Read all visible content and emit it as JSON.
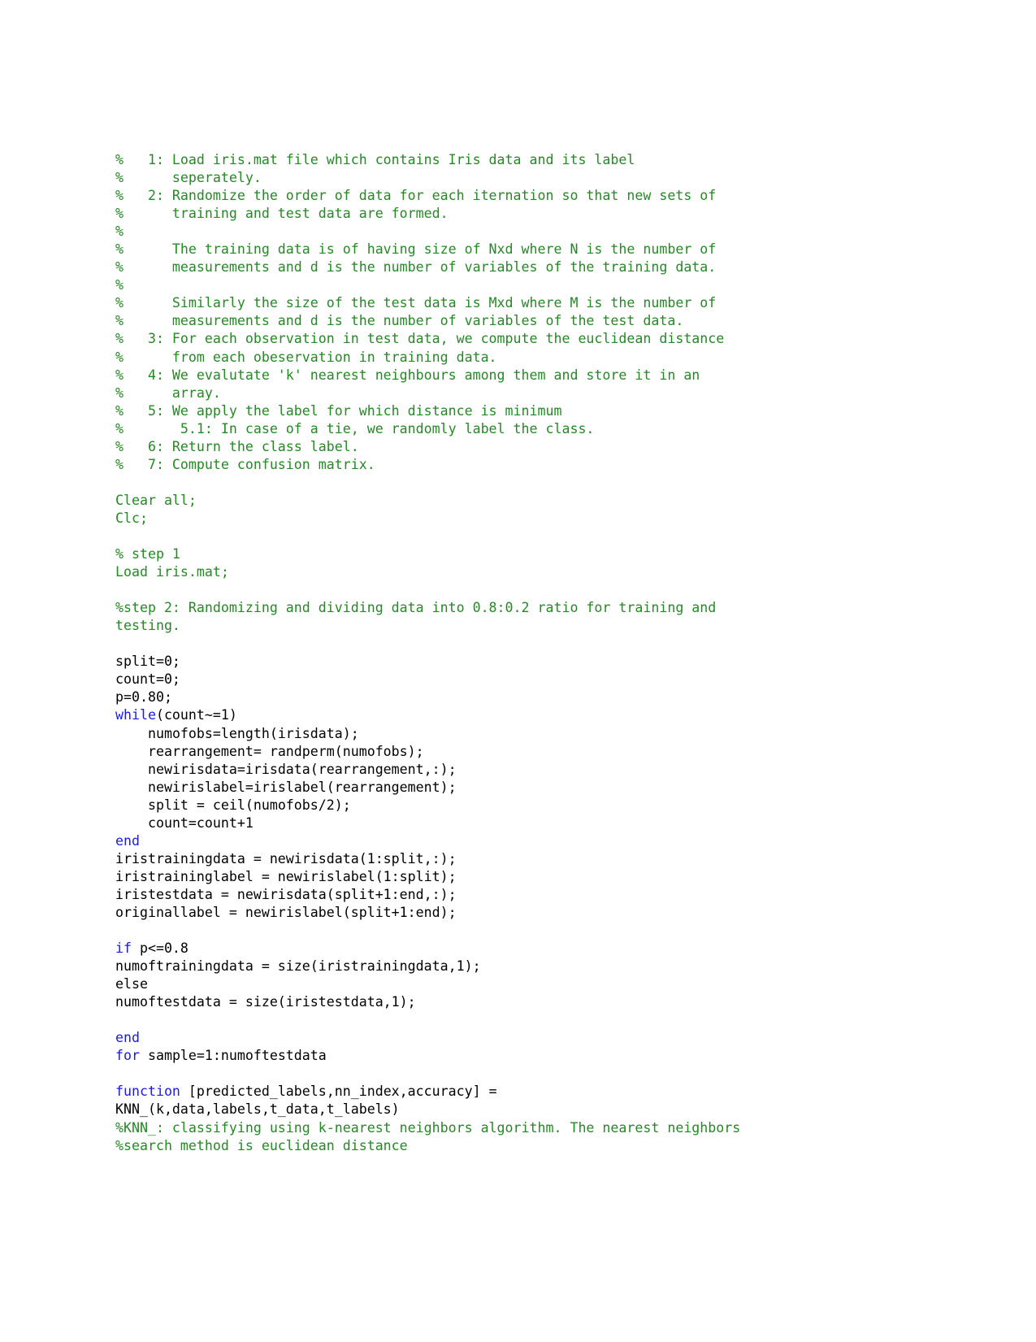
{
  "document": {
    "type": "matlab-source-listing",
    "page_background": "#ffffff",
    "colors": {
      "comment": "#228b22",
      "keyword": "#1a1aee",
      "code": "#000000"
    },
    "lines": [
      {
        "id": "l1",
        "kind": "comment",
        "text": "%   1: Load iris.mat file which contains Iris data and its label"
      },
      {
        "id": "l2",
        "kind": "comment",
        "text": "%      seperately."
      },
      {
        "id": "l3",
        "kind": "comment",
        "text": "%   2: Randomize the order of data for each iternation so that new sets of"
      },
      {
        "id": "l4",
        "kind": "comment",
        "text": "%      training and test data are formed."
      },
      {
        "id": "l5",
        "kind": "comment",
        "text": "%"
      },
      {
        "id": "l6",
        "kind": "comment",
        "text": "%      The training data is of having size of Nxd where N is the number of"
      },
      {
        "id": "l7",
        "kind": "comment",
        "text": "%      measurements and d is the number of variables of the training data."
      },
      {
        "id": "l8",
        "kind": "comment",
        "text": "%"
      },
      {
        "id": "l9",
        "kind": "comment",
        "text": "%      Similarly the size of the test data is Mxd where M is the number of"
      },
      {
        "id": "l10",
        "kind": "comment",
        "text": "%      measurements and d is the number of variables of the test data."
      },
      {
        "id": "l11",
        "kind": "comment",
        "text": "%   3: For each observation in test data, we compute the euclidean distance"
      },
      {
        "id": "l12",
        "kind": "comment",
        "text": "%      from each obeservation in training data."
      },
      {
        "id": "l13",
        "kind": "comment",
        "text": "%   4: We evalutate 'k' nearest neighbours among them and store it in an"
      },
      {
        "id": "l14",
        "kind": "comment",
        "text": "%      array."
      },
      {
        "id": "l15",
        "kind": "comment",
        "text": "%   5: We apply the label for which distance is minimum"
      },
      {
        "id": "l16",
        "kind": "comment",
        "text": "%       5.1: In case of a tie, we randomly label the class."
      },
      {
        "id": "l17",
        "kind": "comment",
        "text": "%   6: Return the class label."
      },
      {
        "id": "l18",
        "kind": "comment",
        "text": "%   7: Compute confusion matrix."
      },
      {
        "id": "l19",
        "kind": "blank",
        "text": ""
      },
      {
        "id": "l20",
        "kind": "comment",
        "text": "Clear all;"
      },
      {
        "id": "l21",
        "kind": "comment",
        "text": "Clc;"
      },
      {
        "id": "l22",
        "kind": "blank",
        "text": ""
      },
      {
        "id": "l23",
        "kind": "comment",
        "text": "% step 1"
      },
      {
        "id": "l24",
        "kind": "comment",
        "text": "Load iris.mat;"
      },
      {
        "id": "l25",
        "kind": "blank",
        "text": ""
      },
      {
        "id": "l26",
        "kind": "comment",
        "text": "%step 2: Randomizing and dividing data into 0.8:0.2 ratio for training and"
      },
      {
        "id": "l27",
        "kind": "comment",
        "text": "testing."
      },
      {
        "id": "l28",
        "kind": "blank",
        "text": ""
      },
      {
        "id": "l29",
        "kind": "code",
        "text": "split=0;"
      },
      {
        "id": "l30",
        "kind": "code",
        "text": "count=0;"
      },
      {
        "id": "l31",
        "kind": "code",
        "text": "p=0.80;"
      },
      {
        "id": "l32",
        "kind": "mixed",
        "keyword": "while",
        "text": "(count~=1)"
      },
      {
        "id": "l33",
        "kind": "code",
        "text": "    numofobs=length(irisdata);"
      },
      {
        "id": "l34",
        "kind": "code",
        "text": "    rearrangement= randperm(numofobs);"
      },
      {
        "id": "l35",
        "kind": "code",
        "text": "    newirisdata=irisdata(rearrangement,:);"
      },
      {
        "id": "l36",
        "kind": "code",
        "text": "    newirislabel=irislabel(rearrangement);"
      },
      {
        "id": "l37",
        "kind": "code",
        "text": "    split = ceil(numofobs/2);"
      },
      {
        "id": "l38",
        "kind": "code",
        "text": "    count=count+1"
      },
      {
        "id": "l39",
        "kind": "mixed",
        "keyword": "end",
        "text": ""
      },
      {
        "id": "l40",
        "kind": "code",
        "text": "iristrainingdata = newirisdata(1:split,:);"
      },
      {
        "id": "l41",
        "kind": "code",
        "text": "iristraininglabel = newirislabel(1:split);"
      },
      {
        "id": "l42",
        "kind": "code",
        "text": "iristestdata = newirisdata(split+1:end,:);"
      },
      {
        "id": "l43",
        "kind": "code",
        "text": "originallabel = newirislabel(split+1:end);"
      },
      {
        "id": "l44",
        "kind": "blank",
        "text": ""
      },
      {
        "id": "l45",
        "kind": "mixed",
        "keyword": "if",
        "text": " p<=0.8"
      },
      {
        "id": "l46",
        "kind": "code",
        "text": "numoftrainingdata = size(iristrainingdata,1);"
      },
      {
        "id": "l47",
        "kind": "code",
        "text": "else"
      },
      {
        "id": "l48",
        "kind": "code",
        "text": "numoftestdata = size(iristestdata,1);"
      },
      {
        "id": "l49",
        "kind": "blank",
        "text": ""
      },
      {
        "id": "l50",
        "kind": "mixed",
        "keyword": "end",
        "text": ""
      },
      {
        "id": "l51",
        "kind": "mixed",
        "keyword": "for",
        "text": " sample=1:numoftestdata"
      },
      {
        "id": "l52",
        "kind": "blank",
        "text": ""
      },
      {
        "id": "l53",
        "kind": "mixed",
        "keyword": "function",
        "text": " [predicted_labels,nn_index,accuracy] ="
      },
      {
        "id": "l54",
        "kind": "code",
        "text": "KNN_(k,data,labels,t_data,t_labels)"
      },
      {
        "id": "l55",
        "kind": "comment",
        "text": "%KNN_: classifying using k-nearest neighbors algorithm. The nearest neighbors"
      },
      {
        "id": "l56",
        "kind": "comment",
        "text": "%search method is euclidean distance"
      }
    ]
  }
}
